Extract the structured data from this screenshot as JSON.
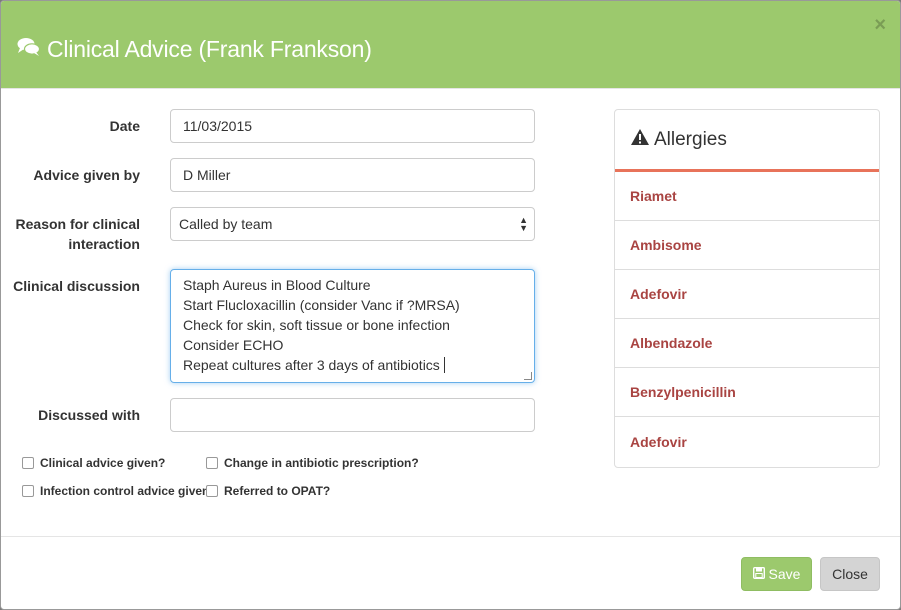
{
  "modal": {
    "title": "Clinical Advice (Frank Frankson)",
    "close_symbol": "×",
    "title_icon": "comments-icon",
    "header_color": "#9cc96d"
  },
  "form": {
    "date": {
      "label": "Date",
      "value": "11/03/2015"
    },
    "advice_given_by": {
      "label": "Advice given by",
      "value": "D Miller"
    },
    "reason": {
      "label_line1": "Reason for clinical",
      "label_line2": "interaction",
      "value": "Called by team"
    },
    "clinical_discussion": {
      "label": "Clinical discussion",
      "lines": [
        "Staph Aureus in Blood Culture",
        "Start Flucloxacillin (consider Vanc if ?MRSA)",
        "Check for skin, soft tissue or bone infection",
        "Consider ECHO",
        "Repeat cultures after 3 days of antibiotics"
      ]
    },
    "discussed_with": {
      "label": "Discussed with",
      "value": ""
    },
    "checkboxes": {
      "clinical_advice_given": "Clinical advice given?",
      "change_in_antibiotic": "Change in antibiotic prescription?",
      "infection_control": "Infection control advice given?",
      "referred_to_opat": "Referred to OPAT?"
    }
  },
  "allergies": {
    "title": "Allergies",
    "icon": "warning-icon",
    "accent_color": "#e8735a",
    "items": [
      "Riamet",
      "Ambisome",
      "Adefovir",
      "Albendazole",
      "Benzylpenicillin",
      "Adefovir"
    ]
  },
  "footer": {
    "save_label": "Save",
    "close_label": "Close"
  }
}
